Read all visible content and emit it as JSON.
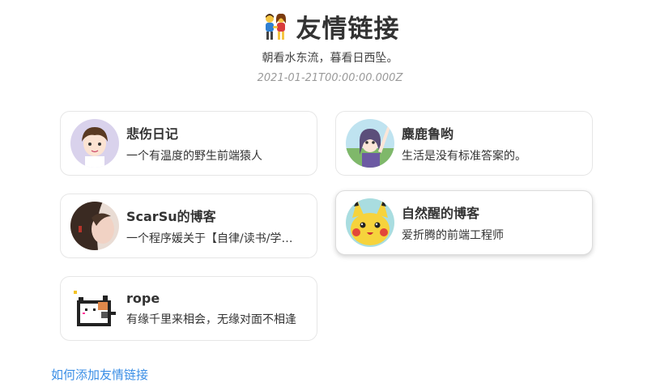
{
  "header": {
    "emoji_icon": "couple-holding-hands-icon",
    "title": "友情链接",
    "subtitle": "朝看水东流，暮看日西坠。",
    "date": "2021-01-21T00:00:00.000Z"
  },
  "friends": [
    {
      "name": "悲伤日记",
      "desc": "一个有温度的野生前端猿人",
      "avatar_icon": "anime-boy-avatar-icon"
    },
    {
      "name": "麋鹿鲁哟",
      "desc": "生活是没有标准答案的。",
      "avatar_icon": "anime-girl-waving-avatar-icon"
    },
    {
      "name": "ScarSu的博客",
      "desc": "一个程序媛关于【自律/读书/学习】",
      "avatar_icon": "girl-photo-avatar-icon"
    },
    {
      "name": "自然醒的博客",
      "desc": "爱折腾的前端工程师",
      "avatar_icon": "pikachu-avatar-icon"
    },
    {
      "name": "rope",
      "desc": "有缘千里来相会，无缘对面不相逢",
      "avatar_icon": "pixel-cat-avatar-icon"
    }
  ],
  "footer": {
    "add_link_text": "如何添加友情链接"
  },
  "colors": {
    "link": "#3a8ee6",
    "card_border": "#e6e6e6",
    "text": "#333333",
    "date": "#9a9a9a"
  }
}
